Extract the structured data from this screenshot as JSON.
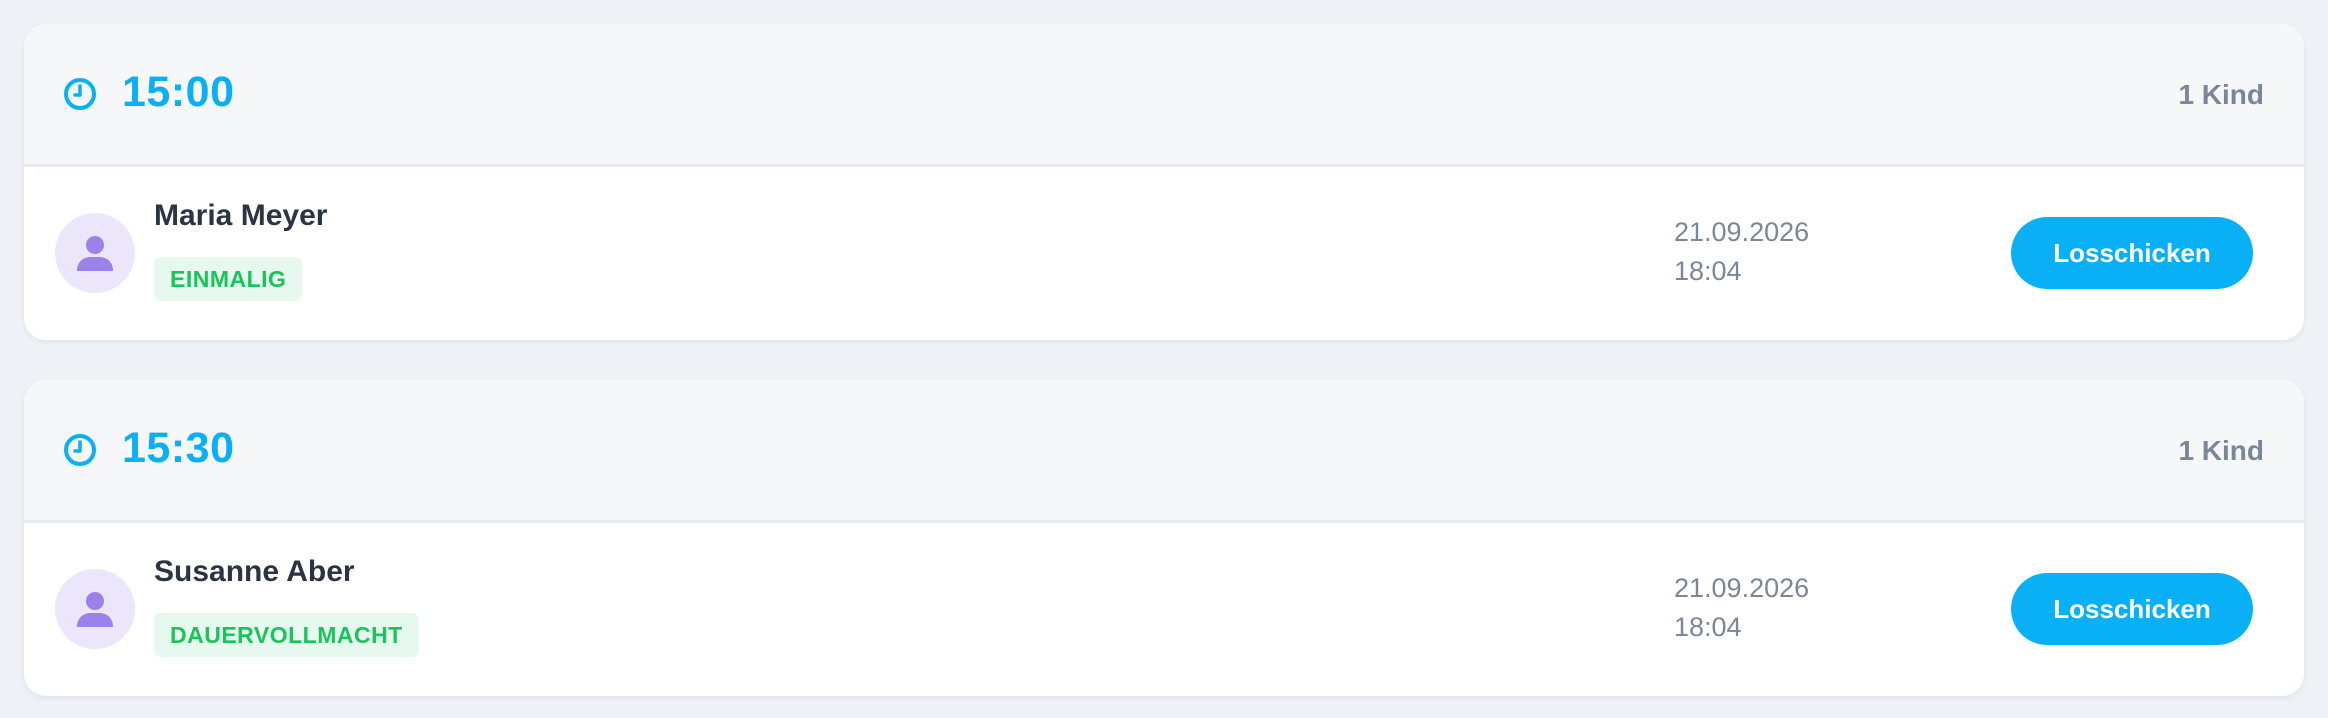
{
  "slots": [
    {
      "time": "15:00",
      "count": "1 Kind",
      "child": {
        "name": "Maria Meyer",
        "badge": "EINMALIG",
        "date": "21.09.2026",
        "time": "18:04",
        "button_label": "Losschicken"
      }
    },
    {
      "time": "15:30",
      "count": "1 Kind",
      "child": {
        "name": "Susanne Aber",
        "badge": "DAUERVOLLMACHT",
        "date": "21.09.2026",
        "time": "18:04",
        "button_label": "Losschicken"
      }
    }
  ],
  "icons": {
    "time": "clock-icon",
    "avatar": "user-icon"
  },
  "colors": {
    "accent": "#0ab0f6",
    "badge_text": "#19c45a",
    "badge_background": "#e7f8ee",
    "avatar_background": "#ebe6fa",
    "avatar_icon": "#9b82ea",
    "muted_text": "#7b8698",
    "name_text": "#2c3444",
    "header_background": "#f6f7f9",
    "page_background": "#eef1f5"
  }
}
